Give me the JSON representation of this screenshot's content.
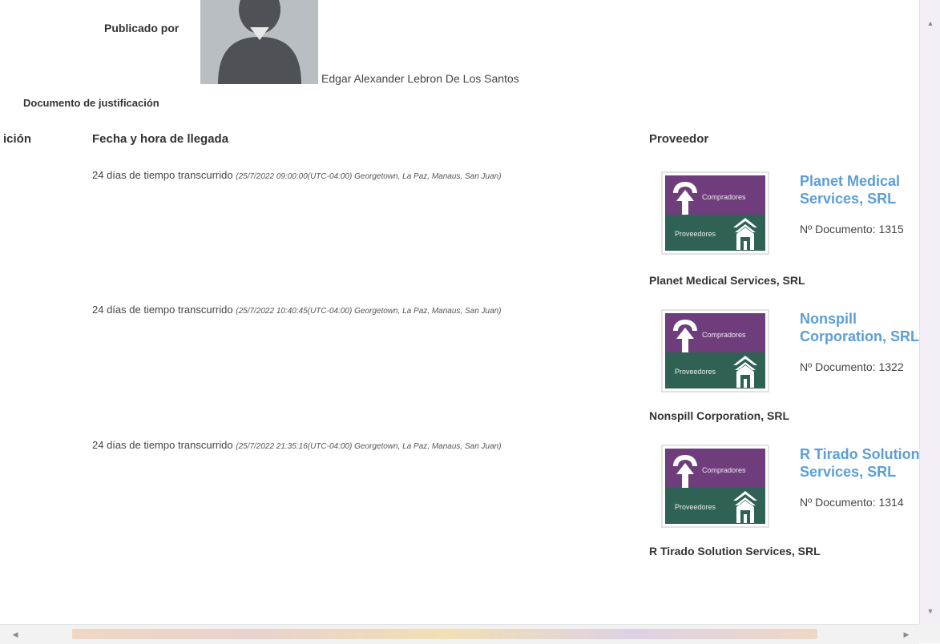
{
  "publisher": {
    "label": "Publicado por",
    "name": "Edgar Alexander Lebron De Los Santos"
  },
  "justification": {
    "label": "Documento de justificación"
  },
  "table": {
    "headers": {
      "partial": "ición",
      "arrival": "Fecha y hora de llegada",
      "supplier": "Proveedor"
    },
    "rows": [
      {
        "elapsed": "24 días de tiempo transcurrido",
        "timestamp": "(25/7/2022 09:00:00(UTC-04:00) Georgetown, La Paz, Manaus, San Juan)",
        "supplier_link": "Planet Medical Services, SRL",
        "doc": "Nº Documento: 1315",
        "supplier_name": "Planet Medical Services, SRL"
      },
      {
        "elapsed": "24 días de tiempo transcurrido",
        "timestamp": "(25/7/2022 10:40:45(UTC-04:00) Georgetown, La Paz, Manaus, San Juan)",
        "supplier_link": "Nonspill Corporation, SRL",
        "doc": "Nº Documento: 1322",
        "supplier_name": "Nonspill Corporation, SRL"
      },
      {
        "elapsed": "24 días de tiempo transcurrido",
        "timestamp": "(25/7/2022 21:35:16(UTC-04:00) Georgetown, La Paz, Manaus, San Juan)",
        "supplier_link": "R Tirado Solution Services, SRL",
        "doc": "Nº Documento: 1314",
        "supplier_name": "R Tirado Solution Services, SRL"
      }
    ]
  },
  "logo": {
    "top_text": "Compradores",
    "bottom_text": "Proveedores",
    "colors": {
      "top": "#6f3d7b",
      "bottom": "#2f6154",
      "link": "#5b9ed8"
    }
  },
  "icons": {
    "scroll_up": "▲",
    "scroll_down": "▼",
    "scroll_left": "◀",
    "scroll_right": "▶"
  }
}
